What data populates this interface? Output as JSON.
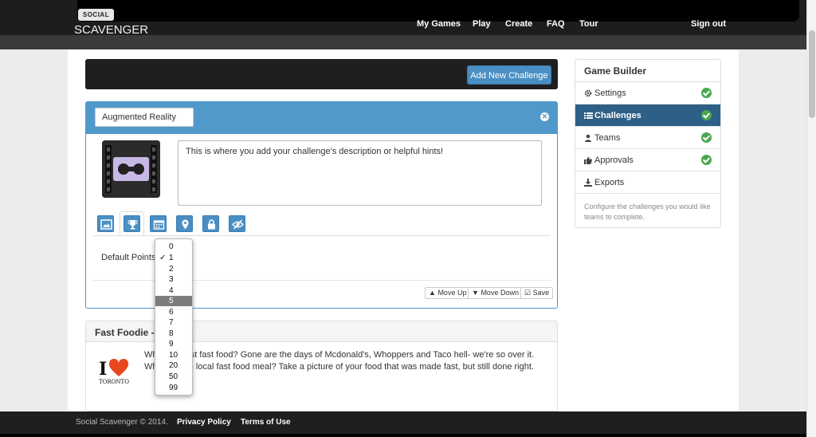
{
  "header": {
    "logo_badge": "SOCIAL",
    "logo_text": "SCAVENGER",
    "nav": [
      "My Games",
      "Play",
      "Create",
      "FAQ",
      "Tour"
    ],
    "signout": "Sign out"
  },
  "toolbar": {
    "add_challenge": "Add New Challenge"
  },
  "challenge": {
    "name_value": "Augmented Reality",
    "description": "This is where you add your challenge's description or helpful hints!",
    "default_points_label": "Default Points:",
    "tabs": [
      "image-icon",
      "trophy-icon",
      "calendar-icon",
      "map-marker-icon",
      "lock-icon",
      "eye-slash-icon"
    ],
    "buttons": {
      "move_up": "Move Up",
      "move_down": "Move Down",
      "save": "Save"
    }
  },
  "points_dropdown": {
    "options": [
      "0",
      "1",
      "2",
      "3",
      "4",
      "5",
      "6",
      "7",
      "8",
      "9",
      "10",
      "20",
      "50",
      "99"
    ],
    "checked": "1",
    "highlighted": "5"
  },
  "challenge2": {
    "title": "Fast Foodie - 2",
    "line1": "Wh       nto's best fast food? Gone are the days of Mcdonald's, Whoppers and Taco hell- we're so over it.",
    "line2": "Wh         favourite local fast food meal? Take a picture of your food that was made fast, but still done right.",
    "logo_i": "I",
    "logo_city": "TORONTO"
  },
  "sidebar": {
    "title": "Game Builder",
    "items": [
      {
        "label": "Settings",
        "icon": "gear-icon",
        "done": true
      },
      {
        "label": "Challenges",
        "icon": "list-icon",
        "done": true,
        "active": true
      },
      {
        "label": "Teams",
        "icon": "user-icon",
        "done": true
      },
      {
        "label": "Approvals",
        "icon": "thumbs-up-icon",
        "done": true
      },
      {
        "label": "Exports",
        "icon": "download-icon",
        "done": false
      }
    ],
    "help": "Configure the challenges you would like teams to complete."
  },
  "footer": {
    "copyright": "Social Scavenger © 2014.",
    "privacy": "Privacy Policy",
    "terms": "Terms of Use"
  },
  "colors": {
    "accent": "#4a8fc4",
    "panel_head": "#5198cb",
    "active_item": "#2e5f86",
    "check": "#4aa84f"
  }
}
